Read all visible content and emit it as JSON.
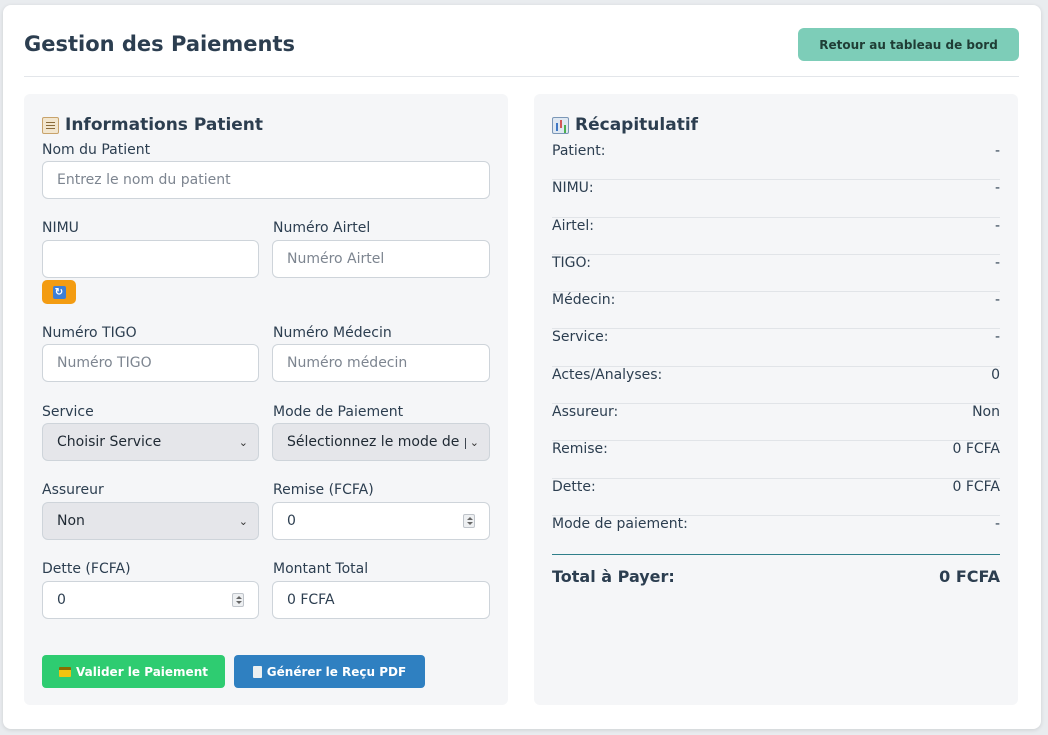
{
  "header": {
    "title": "Gestion des Paiements",
    "back_label": "Retour au tableau de bord"
  },
  "patient": {
    "section_title": "Informations Patient",
    "section_icon": "clipboard-icon",
    "name_label": "Nom du Patient",
    "name_placeholder": "Entrez le nom du patient",
    "nimu_label": "NIMU",
    "nimu_value": "",
    "airtel_label": "Numéro Airtel",
    "airtel_placeholder": "Numéro Airtel",
    "tigo_label": "Numéro TIGO",
    "tigo_placeholder": "Numéro TIGO",
    "medecin_label": "Numéro Médecin",
    "medecin_placeholder": "Numéro médecin",
    "service_label": "Service",
    "service_value": "Choisir Service",
    "mode_label": "Mode de Paiement",
    "mode_value": "Sélectionnez le mode de paiement",
    "assureur_label": "Assureur",
    "assureur_value": "Non",
    "remise_label": "Remise (FCFA)",
    "remise_value": "0",
    "dette_label": "Dette (FCFA)",
    "dette_value": "0",
    "total_label": "Montant Total",
    "total_value": "0 FCFA",
    "validate_label": "Valider le Paiement",
    "pdf_label": "Générer le Reçu PDF"
  },
  "summary": {
    "section_title": "Récapitulatif",
    "section_icon": "bar-chart-icon",
    "rows": [
      {
        "label": "Patient:",
        "value": "-"
      },
      {
        "label": "NIMU:",
        "value": "-"
      },
      {
        "label": "Airtel:",
        "value": "-"
      },
      {
        "label": "TIGO:",
        "value": "-"
      },
      {
        "label": "Médecin:",
        "value": "-"
      },
      {
        "label": "Service:",
        "value": "-"
      },
      {
        "label": "Actes/Analyses:",
        "value": "0"
      },
      {
        "label": "Assureur:",
        "value": "Non"
      },
      {
        "label": "Remise:",
        "value": "0 FCFA"
      },
      {
        "label": "Dette:",
        "value": "0 FCFA"
      },
      {
        "label": "Mode de paiement:",
        "value": "-"
      }
    ],
    "total_label": "Total à Payer:",
    "total_value": "0 FCFA"
  },
  "colors": {
    "back_button": "#7dcdb8",
    "validate_button": "#2ecc71",
    "pdf_button": "#2f80c1",
    "refresh_button": "#f39c12"
  }
}
